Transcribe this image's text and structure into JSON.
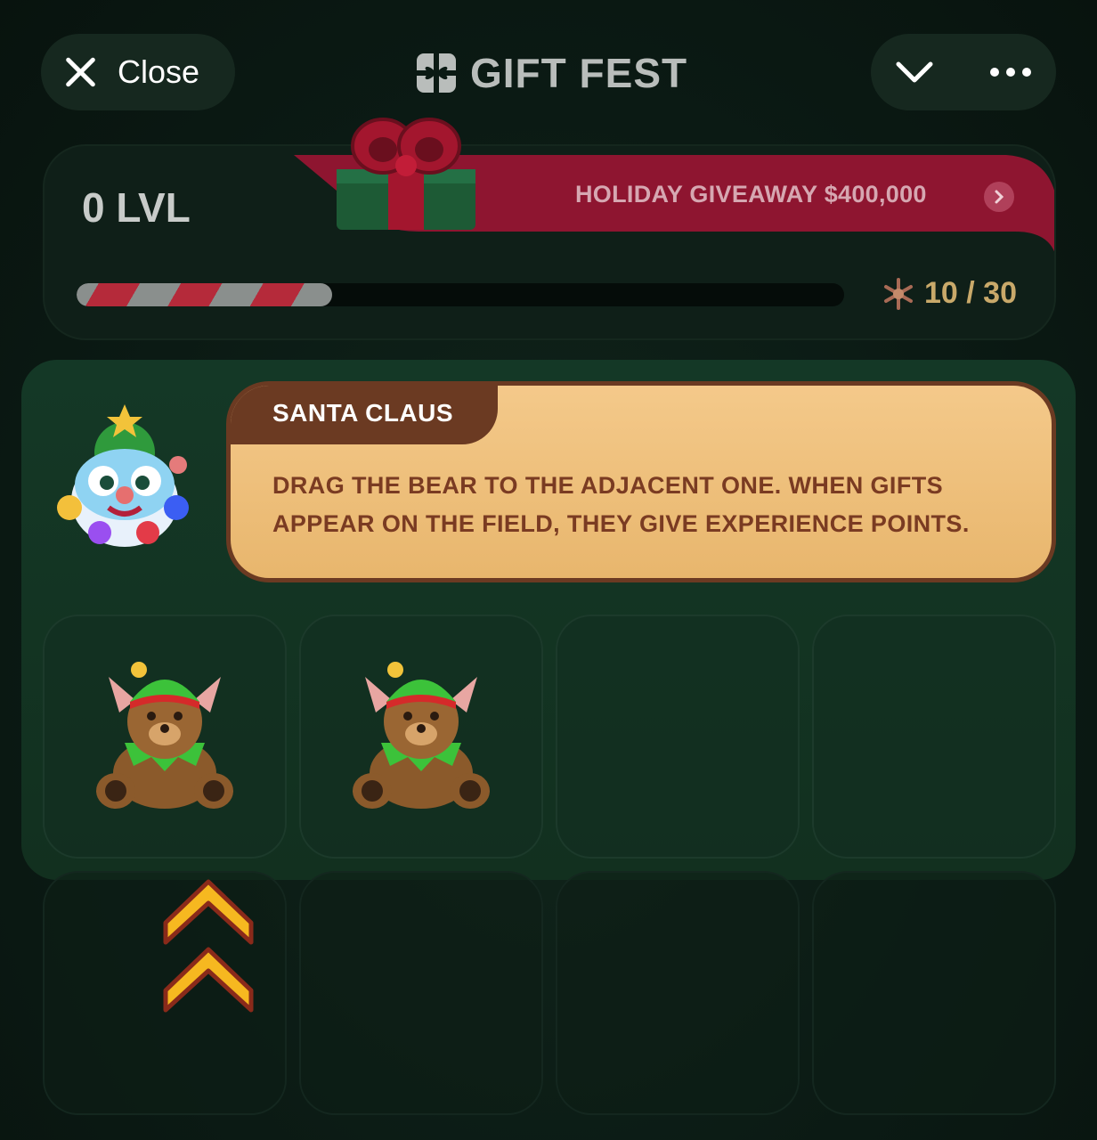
{
  "header": {
    "close_label": "Close",
    "title": "GIFT FEST"
  },
  "level": {
    "label": "0 LVL",
    "giveaway": "HOLIDAY GIVEAWAY $400,000",
    "progress_fraction": 0.333,
    "xp_text": "10 / 30"
  },
  "tutorial": {
    "speaker": "SANTA CLAUS",
    "message": "DRAG THE BEAR TO THE ADJACENT ONE. WHEN GIFTS APPEAR ON THE FIELD, THEY GIVE EXPERIENCE POINTS."
  },
  "board": {
    "items": [
      "elf-bear",
      "elf-bear",
      "",
      "",
      "",
      "",
      "",
      ""
    ]
  },
  "colors": {
    "accent_red": "#8e1530",
    "bubble": "#f0c27e",
    "bubble_border": "#6b3a22"
  }
}
